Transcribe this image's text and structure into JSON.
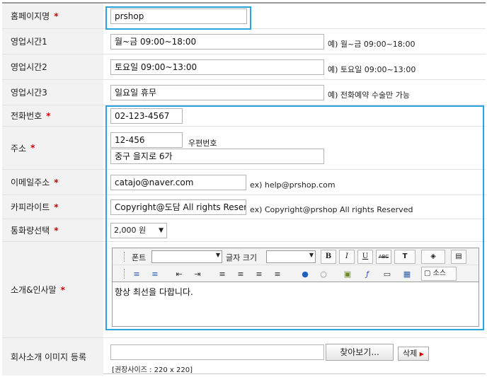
{
  "fields": {
    "homepage_name": {
      "label": "홈페이지명",
      "required": "*",
      "value": "prshop"
    },
    "hours1": {
      "label": "영업시간1",
      "value": "월~금 09:00~18:00",
      "hint": "예) 월~금 09:00~18:00"
    },
    "hours2": {
      "label": "영업시간2",
      "value": "토요일 09:00~13:00",
      "hint": "예) 토요일 09:00~13:00"
    },
    "hours3": {
      "label": "영업시간3",
      "value": "일요일 휴무",
      "hint": "예) 전화예약 수술만 가능"
    },
    "phone": {
      "label": "전화번호",
      "required": "*",
      "value": "02-123-4567"
    },
    "address": {
      "label": "주소",
      "required": "*",
      "zip": "12-456",
      "zip_label": "우편번호",
      "street": "중구 을지로 6가"
    },
    "email": {
      "label": "이메일주소",
      "required": "*",
      "value": "catajo@naver.com",
      "hint": "ex) help@prshop.com"
    },
    "copyright": {
      "label": "카피라이트",
      "required": "*",
      "value": "Copyright@도담 All rights Reserved",
      "hint": "ex) Copyright@prshop All rights Reserved"
    },
    "currency": {
      "label": "통화량선택",
      "required": "*",
      "selected": "2,000 원"
    },
    "intro": {
      "label": "소개&인사말",
      "required": "*",
      "content": "항상 최선을 다합니다."
    },
    "company_image": {
      "label": "회사소개 이미지 등록",
      "file_value": "",
      "browse_label": "찾아보기...",
      "delete_label": "삭제",
      "size_hint": "[권장사이즈 : 220 x 220]"
    }
  },
  "editor": {
    "font_label": "폰트",
    "size_label": "글자 크기",
    "source_label": "소스",
    "icons": {
      "bold": "B",
      "italic": "I",
      "underline": "U",
      "strike": "ABC",
      "text_color": "T",
      "bg_color": "◈",
      "paste": "▤",
      "ordered_list": "≡",
      "unordered_list": "≡",
      "outdent": "⇤",
      "indent": "⇥",
      "align_left": "≡",
      "align_center": "≡",
      "align_right": "≡",
      "justify": "≡",
      "link": "●",
      "unlink": "○",
      "image": "▣",
      "flash": "ƒ",
      "table": "▭",
      "media": "▦",
      "source": "▢"
    }
  },
  "colors": {
    "highlight": "#2aa3e0",
    "required": "#d40000",
    "label_bg": "#f2f2f2"
  }
}
